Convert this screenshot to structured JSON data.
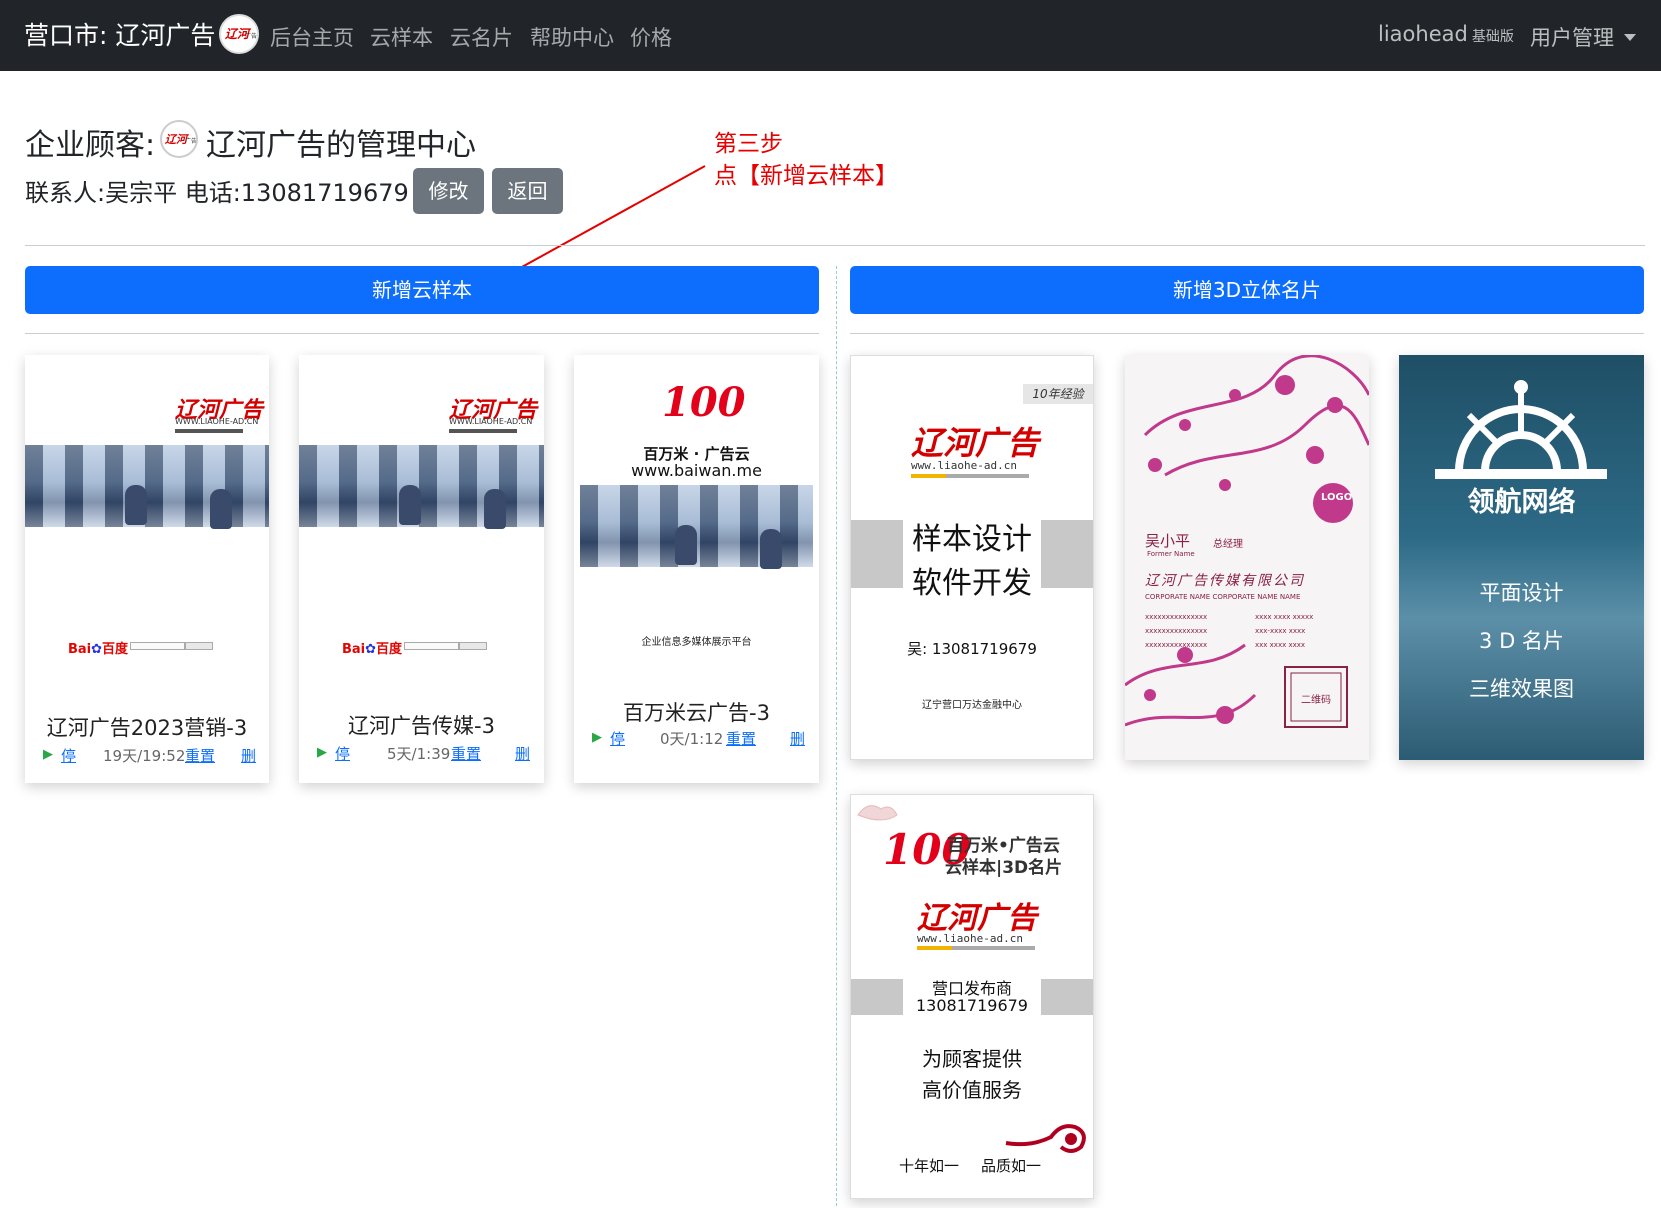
{
  "navbar": {
    "brand": "营口市: 辽河广告",
    "links": [
      "后台主页",
      "云样本",
      "云名片",
      "帮助中心",
      "价格"
    ],
    "user": "liaohead",
    "user_tier": "基础版",
    "user_menu": "用户管理"
  },
  "header": {
    "title_prefix": "企业顾客:",
    "title_name": "辽河广告的管理中心",
    "contact": "联系人:吴宗平 电话:13081719679",
    "edit_button": "修改",
    "back_button": "返回"
  },
  "annotation": {
    "line1": "第三步",
    "line2": "点【新增云样本】",
    "color": "#e60000"
  },
  "actions": {
    "add_sample": "新增云样本",
    "add_card": "新增3D立体名片"
  },
  "samples": [
    {
      "title": "辽河广告2023营销-3",
      "play": "▶",
      "stop": "停",
      "stats": "19天/19:52",
      "reset": "重置",
      "delete": "删",
      "logo_text": "辽河广告",
      "logo_sub": "WWW.LIAOHE-AD.CN",
      "baidu": "百度"
    },
    {
      "title": "辽河广告传媒-3",
      "play": "▶",
      "stop": "停",
      "stats": "5天/1:39",
      "reset": "重置",
      "delete": "删",
      "logo_text": "辽河广告",
      "logo_sub": "WWW.LIAOHE-AD.CN",
      "baidu": "百度"
    },
    {
      "title": "百万米云广告-3",
      "play": "▶",
      "stop": "停",
      "stats": "0天/1:12",
      "reset": "重置",
      "delete": "删",
      "logo_100": "100",
      "brand_line": "百万米 · 广告云",
      "url_line": "www.baiwan.me",
      "footer": "企业信息多媒体展示平台"
    }
  ],
  "cards": [
    {
      "badge": "10年经验",
      "logo_text": "辽河广告",
      "logo_sub": "www.liaohe-ad.cn",
      "line1": "样本设计",
      "line2": "软件开发",
      "phone": "吴: 13081719679",
      "address": "辽宁营口万达金融中心"
    },
    {
      "name": "吴小平",
      "name_en": "Former Name",
      "job": "总经理",
      "company": "辽河广告传媒有限公司",
      "company_en": "CORPORATE NAME CORPORATE NAME NAME",
      "logo": "LOGO",
      "qr": "二维码",
      "info_left": [
        "xxxxxxxxxxxxxxx",
        "xxxxxxxxxxxxxxx",
        "xxxxxxxxxxxxxxx"
      ],
      "info_right": [
        "xxxx xxxx xxxxx",
        "xxx-xxxx xxxx",
        "xxx xxxx xxxx"
      ]
    },
    {
      "title": "领航网络",
      "items": [
        "平面设计",
        "3 D 名片",
        "三维效果图"
      ]
    },
    {
      "logo_100": "100",
      "brand_line1": "百万米•广告云",
      "brand_line2": "云样本|3D名片",
      "logo_text": "辽河广告",
      "logo_sub": "www.liaohe-ad.cn",
      "publisher": "营口发布商",
      "phone": "13081719679",
      "slogan1": "为顾客提供",
      "slogan2": "高价值服务",
      "footer1": "十年如一",
      "footer2": "品质如一"
    }
  ],
  "colors": {
    "primary": "#0d6efd",
    "secondary": "#6c757d",
    "navbar": "#212529",
    "logo_red": "#d40000",
    "magenta": "#c0398a"
  }
}
